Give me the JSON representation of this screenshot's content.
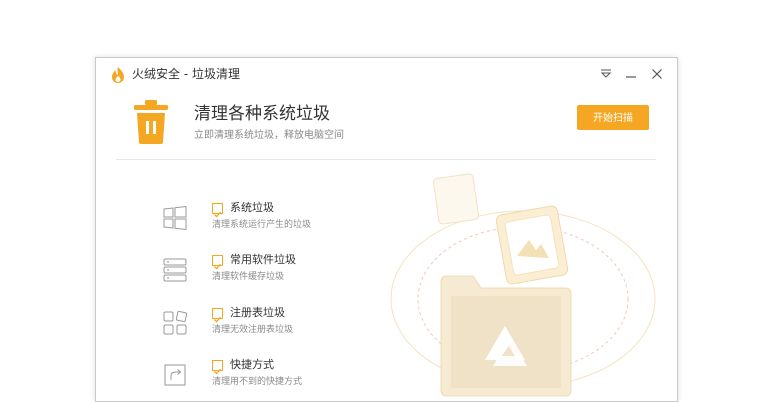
{
  "window": {
    "title": "火绒安全 - 垃圾清理"
  },
  "titlebar_buttons": [
    "menu-icon",
    "minimize-icon",
    "close-icon"
  ],
  "header": {
    "title": "清理各种系统垃圾",
    "subtitle": "立即清理系统垃圾，释放电脑空间",
    "start_button_label": "开始扫描"
  },
  "items": [
    {
      "label": "系统垃圾",
      "desc": "清理系统运行产生的垃圾",
      "icon": "windows-icon",
      "checked": true
    },
    {
      "label": "常用软件垃圾",
      "desc": "清理软件缓存垃圾",
      "icon": "software-icon",
      "checked": true
    },
    {
      "label": "注册表垃圾",
      "desc": "清理无效注册表垃圾",
      "icon": "registry-icon",
      "checked": true
    },
    {
      "label": "快捷方式",
      "desc": "清理用不到的快捷方式",
      "icon": "shortcut-icon",
      "checked": true
    }
  ],
  "colors": {
    "accent": "#f5a623",
    "title_text": "#333333",
    "muted_text": "#8a8a8a",
    "illustration": "#f3e3bf"
  }
}
